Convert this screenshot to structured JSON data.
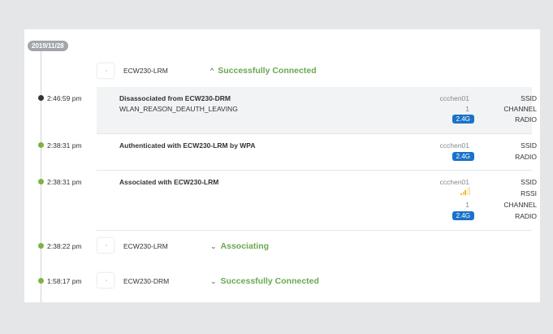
{
  "date": "2019/11/28",
  "groups": [
    {
      "device": "ECW230-LRM",
      "status": "Successfully Connected",
      "chevron": "^"
    },
    {
      "time": "2:38:22 pm",
      "device": "ECW230-LRM",
      "status": "Associating",
      "chevron": "⌄"
    },
    {
      "time": "1:58:17 pm",
      "device": "ECW230-DRM",
      "status": "Successfully Connected",
      "chevron": "⌄"
    }
  ],
  "events": [
    {
      "time": "2:46:59 pm",
      "title": "Disassociated from ECW230-DRM",
      "subtitle": "WLAN_REASON_DEAUTH_LEAVING",
      "ssid": "ccchen01",
      "channel": "1",
      "radio": "2.4G",
      "keys": {
        "ssid": "SSID",
        "channel": "CHANNEL",
        "radio": "RADIO"
      }
    },
    {
      "time": "2:38:31 pm",
      "title": "Authenticated with ECW230-LRM by WPA",
      "ssid": "ccchen01",
      "radio": "2.4G",
      "keys": {
        "ssid": "SSID",
        "radio": "RADIO"
      }
    },
    {
      "time": "2:38:31 pm",
      "title": "Associated with ECW230-LRM",
      "ssid": "ccchen01",
      "rssi_level": 0.3,
      "channel": "1",
      "radio": "2.4G",
      "keys": {
        "ssid": "SSID",
        "rssi": "RSSI",
        "channel": "CHANNEL",
        "radio": "RADIO"
      }
    }
  ],
  "colors": {
    "accent": "#6aa84f",
    "radio_badge": "#1a73c8",
    "rssi": "#f2b51f"
  }
}
